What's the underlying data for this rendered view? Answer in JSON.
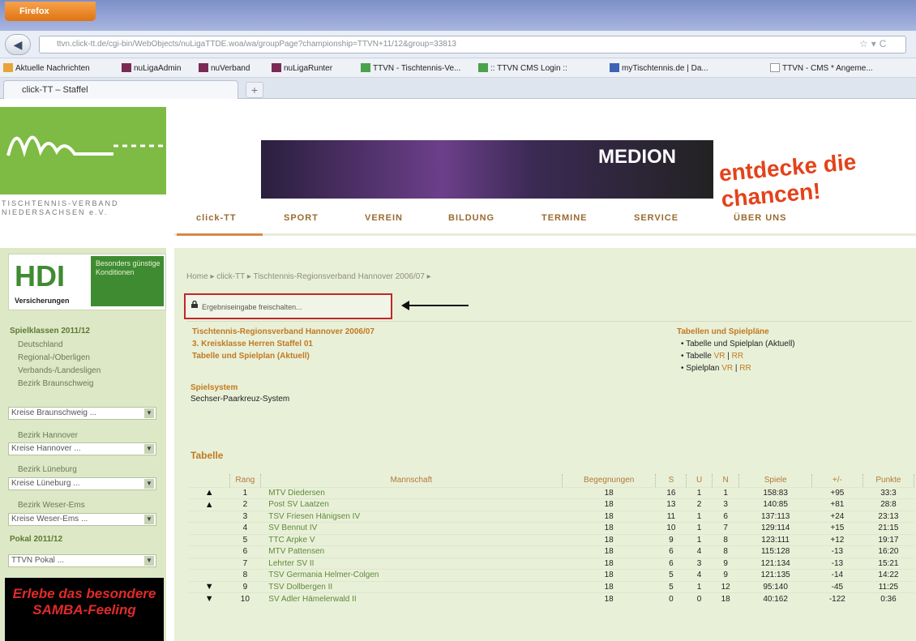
{
  "browser": {
    "menu_button": "Firefox",
    "url": "ttvn.click-tt.de/cgi-bin/WebObjects/nuLigaTTDE.woa/wa/groupPage?championship=TTVN+11/12&group=33813",
    "bookmarks": [
      "Aktuelle Nachrichten",
      "nuLigaAdmin",
      "nuVerband",
      "nuLigaRunter",
      "TTVN - Tischtennis-Ve...",
      ":: TTVN CMS Login ::",
      "myTischtennis.de | Da...",
      "TTVN - CMS * Angeme..."
    ],
    "tab_title": "click-TT – Staffel",
    "new_tab": "+"
  },
  "site": {
    "logo_text": "TISCHTENNIS-VERBAND NIEDERSACHSEN e.V.",
    "banner_brand": "MEDION",
    "banner_slogan": "entdecke die chancen!",
    "menu": [
      "click-TT",
      "SPORT",
      "VEREIN",
      "BILDUNG",
      "TERMINE",
      "SERVICE",
      "ÜBER UNS"
    ]
  },
  "sidebar": {
    "ad_logo": "HDI",
    "ad_sub": "Versicherungen",
    "ad_text": "Besonders günstige Konditionen",
    "season_head": "Spielklassen 2011/12",
    "links": [
      "Deutschland",
      "Regional-/Oberligen",
      "Verbands-/Landesligen",
      "Bezirk Braunschweig"
    ],
    "sel_bs": "Kreise Braunschweig ...",
    "bezirk_hannover": "Bezirk Hannover",
    "sel_han": "Kreise Hannover ...",
    "bezirk_lueneburg": "Bezirk Lüneburg",
    "sel_lue": "Kreise Lüneburg ...",
    "bezirk_weser": "Bezirk Weser-Ems",
    "sel_weser": "Kreise Weser-Ems ...",
    "pokal_head": "Pokal 2011/12",
    "sel_pokal": "TTVN Pokal ...",
    "samba": "Erlebe das besondere SAMBA-Feeling"
  },
  "content": {
    "breadcrumb": "Home ▸ click-TT ▸ Tischtennis-Regionsverband Hannover 2006/07 ▸",
    "lock_link": "Ergebniseingabe freischalten...",
    "org_lines": [
      "Tischtennis-Regionsverband Hannover 2006/07",
      "3. Kreisklasse Herren Staffel 01",
      "Tabelle und Spielplan (Aktuell)"
    ],
    "right_head": "Tabellen und Spielpläne",
    "right_links": {
      "l1": "Tabelle und Spielplan (Aktuell)",
      "l2": "Tabelle",
      "l2a": "VR",
      "l2b": "RR",
      "l3": "Spielplan",
      "l3a": "VR",
      "l3b": "RR"
    },
    "spielsystem_head": "Spielsystem",
    "spielsystem_val": "Sechser-Paarkreuz-System",
    "table_head": "Tabelle"
  },
  "table": {
    "columns": [
      "",
      "Rang",
      "Mannschaft",
      "Begegnungen",
      "S",
      "U",
      "N",
      "Spiele",
      "+/-",
      "Punkte"
    ],
    "rows": [
      {
        "trend": "▲",
        "rang": "1",
        "team": "MTV Diedersen",
        "beg": "18",
        "s": "16",
        "u": "1",
        "n": "1",
        "spiele": "158:83",
        "diff": "+95",
        "punkte": "33:3"
      },
      {
        "trend": "▲",
        "rang": "2",
        "team": "Post SV Laatzen",
        "beg": "18",
        "s": "13",
        "u": "2",
        "n": "3",
        "spiele": "140:85",
        "diff": "+81",
        "punkte": "28:8"
      },
      {
        "trend": "",
        "rang": "3",
        "team": "TSV Friesen Hänigsen IV",
        "beg": "18",
        "s": "11",
        "u": "1",
        "n": "6",
        "spiele": "137:113",
        "diff": "+24",
        "punkte": "23:13"
      },
      {
        "trend": "",
        "rang": "4",
        "team": "SV Bennut IV",
        "beg": "18",
        "s": "10",
        "u": "1",
        "n": "7",
        "spiele": "129:114",
        "diff": "+15",
        "punkte": "21:15"
      },
      {
        "trend": "",
        "rang": "5",
        "team": "TTC Arpke V",
        "beg": "18",
        "s": "9",
        "u": "1",
        "n": "8",
        "spiele": "123:111",
        "diff": "+12",
        "punkte": "19:17"
      },
      {
        "trend": "",
        "rang": "6",
        "team": "MTV Pattensen",
        "beg": "18",
        "s": "6",
        "u": "4",
        "n": "8",
        "spiele": "115:128",
        "diff": "-13",
        "punkte": "16:20"
      },
      {
        "trend": "",
        "rang": "7",
        "team": "Lehrter SV II",
        "beg": "18",
        "s": "6",
        "u": "3",
        "n": "9",
        "spiele": "121:134",
        "diff": "-13",
        "punkte": "15:21"
      },
      {
        "trend": "",
        "rang": "8",
        "team": "TSV Germania Helmer-Colgen",
        "beg": "18",
        "s": "5",
        "u": "4",
        "n": "9",
        "spiele": "121:135",
        "diff": "-14",
        "punkte": "14:22"
      },
      {
        "trend": "▼",
        "rang": "9",
        "team": "TSV Dollbergen II",
        "beg": "18",
        "s": "5",
        "u": "1",
        "n": "12",
        "spiele": "95:140",
        "diff": "-45",
        "punkte": "11:25"
      },
      {
        "trend": "▼",
        "rang": "10",
        "team": "SV Adler Hämelerwald II",
        "beg": "18",
        "s": "0",
        "u": "0",
        "n": "18",
        "spiele": "40:162",
        "diff": "-122",
        "punkte": "0:36"
      }
    ]
  },
  "colors": {
    "accent": "#c07a22",
    "green": "#7dbb44",
    "highlight": "#c0282b"
  }
}
